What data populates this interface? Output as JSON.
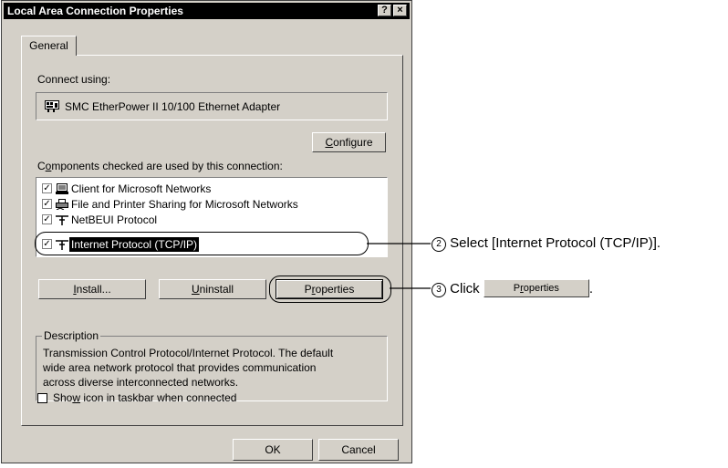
{
  "window": {
    "title": "Local Area Connection Properties",
    "help_glyph": "?",
    "close_glyph": "×"
  },
  "tabs": [
    {
      "label": "General"
    }
  ],
  "connect_using_label": "Connect using:",
  "adapter_name": "SMC EtherPower II 10/100 Ethernet Adapter",
  "configure_button": {
    "prefix": "",
    "key": "C",
    "rest": "onfigure"
  },
  "components_label": {
    "prefix": "C",
    "key": "o",
    "rest": "mponents checked are used by this connection:"
  },
  "components": [
    {
      "label": "Client for Microsoft Networks",
      "checked": true,
      "icon": "network-client-icon"
    },
    {
      "label": "File and Printer Sharing for Microsoft Networks",
      "checked": true,
      "icon": "printer-sharing-icon"
    },
    {
      "label": "NetBEUI Protocol",
      "checked": true,
      "icon": "protocol-icon"
    },
    {
      "label": "Internet Protocol (TCP/IP)",
      "checked": true,
      "icon": "protocol-icon",
      "selected": true
    }
  ],
  "install_button": {
    "prefix": "",
    "key": "I",
    "rest": "nstall..."
  },
  "uninstall_button": {
    "prefix": "",
    "key": "U",
    "rest": "ninstall"
  },
  "properties_button": {
    "prefix": "P",
    "key": "r",
    "rest": "operties"
  },
  "description": {
    "legend": "Description",
    "lines": [
      "Transmission Control Protocol/Internet Protocol. The default",
      "wide area network protocol that provides communication",
      "across diverse interconnected networks."
    ]
  },
  "show_icon": {
    "checked": false,
    "prefix": "Sho",
    "key": "w",
    "rest": " icon in taskbar when connected"
  },
  "ok_label": "OK",
  "cancel_label": "Cancel",
  "annotations": {
    "step2": {
      "number": "2",
      "text": "Select [Internet Protocol (TCP/IP)]."
    },
    "step3": {
      "number": "3",
      "text": "Click",
      "button": {
        "prefix": "P",
        "key": "r",
        "rest": "operties"
      },
      "suffix": "."
    }
  },
  "colors": {
    "dialog_bg": "#d4d0c8",
    "title_bar": "#000000",
    "selection": "#000000"
  }
}
